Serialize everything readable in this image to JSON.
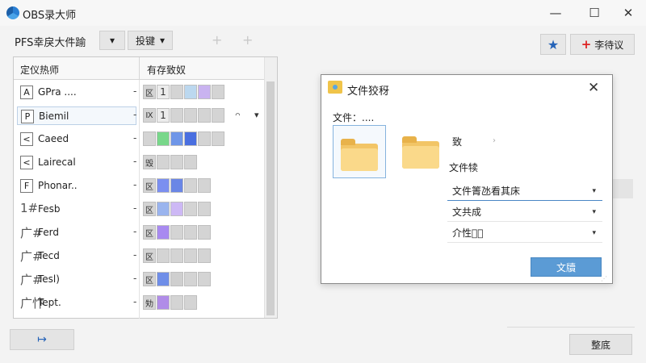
{
  "app": {
    "title": "OBS录大师"
  },
  "window_controls": {
    "minimize": "—",
    "maximize": "☐",
    "close": "✕"
  },
  "toolbar": {
    "label": "PFS幸戾大件踰",
    "dropdown_caret": "▾",
    "shortcut_button": "投键",
    "faint_plus": "+"
  },
  "top_right": {
    "suggest_label": "李待议",
    "suggest_plus": "+"
  },
  "list": {
    "col_name": "定仪热师",
    "col_thumbs": "有存致奴",
    "rows": [
      {
        "key": "A",
        "name": "GPra ....",
        "thumb_code": "区",
        "thumb_num": "1"
      },
      {
        "key": "P",
        "name": "Biemil",
        "thumb_code": "Ⅸ",
        "thumb_num": "1",
        "extra": "ᴖ",
        "extra_caret": "▾"
      },
      {
        "key": "<",
        "name": "Caeed",
        "thumb_code": ""
      },
      {
        "key": "<",
        "name": "Lairecal",
        "thumb_code": "毁"
      },
      {
        "key": "F",
        "name": "Phonar..",
        "thumb_code": "区"
      },
      {
        "key": "1#",
        "name": "Fesb",
        "thumb_code": "区"
      },
      {
        "key": "广#",
        "name": "Ferd",
        "thumb_code": "区"
      },
      {
        "key": "广#",
        "name": "Tecd",
        "thumb_code": "区"
      },
      {
        "key": "广#",
        "name": "Tesl)",
        "thumb_code": "区"
      },
      {
        "key": "广忭",
        "name": "Tept.",
        "thumb_code": "劮"
      }
    ],
    "dash": "-"
  },
  "dialog": {
    "title": "文件狡䄰",
    "close": "✕",
    "file_label": "文件：....",
    "folder2_label": "致",
    "folder2_arrow": "›",
    "section_label": "文件犊",
    "select1": "文件箐氹看其床",
    "select2": "文共成",
    "select3": "介性𤈉𢼸",
    "caret": "▾",
    "primary": "文牘",
    "grip": "⋰"
  },
  "bottom": {
    "left_icon_glyph": "↦",
    "right_button": "整底"
  },
  "colors": {
    "accent": "#5b9bd5",
    "star": "#2563b8",
    "plus_red": "#d22222"
  }
}
